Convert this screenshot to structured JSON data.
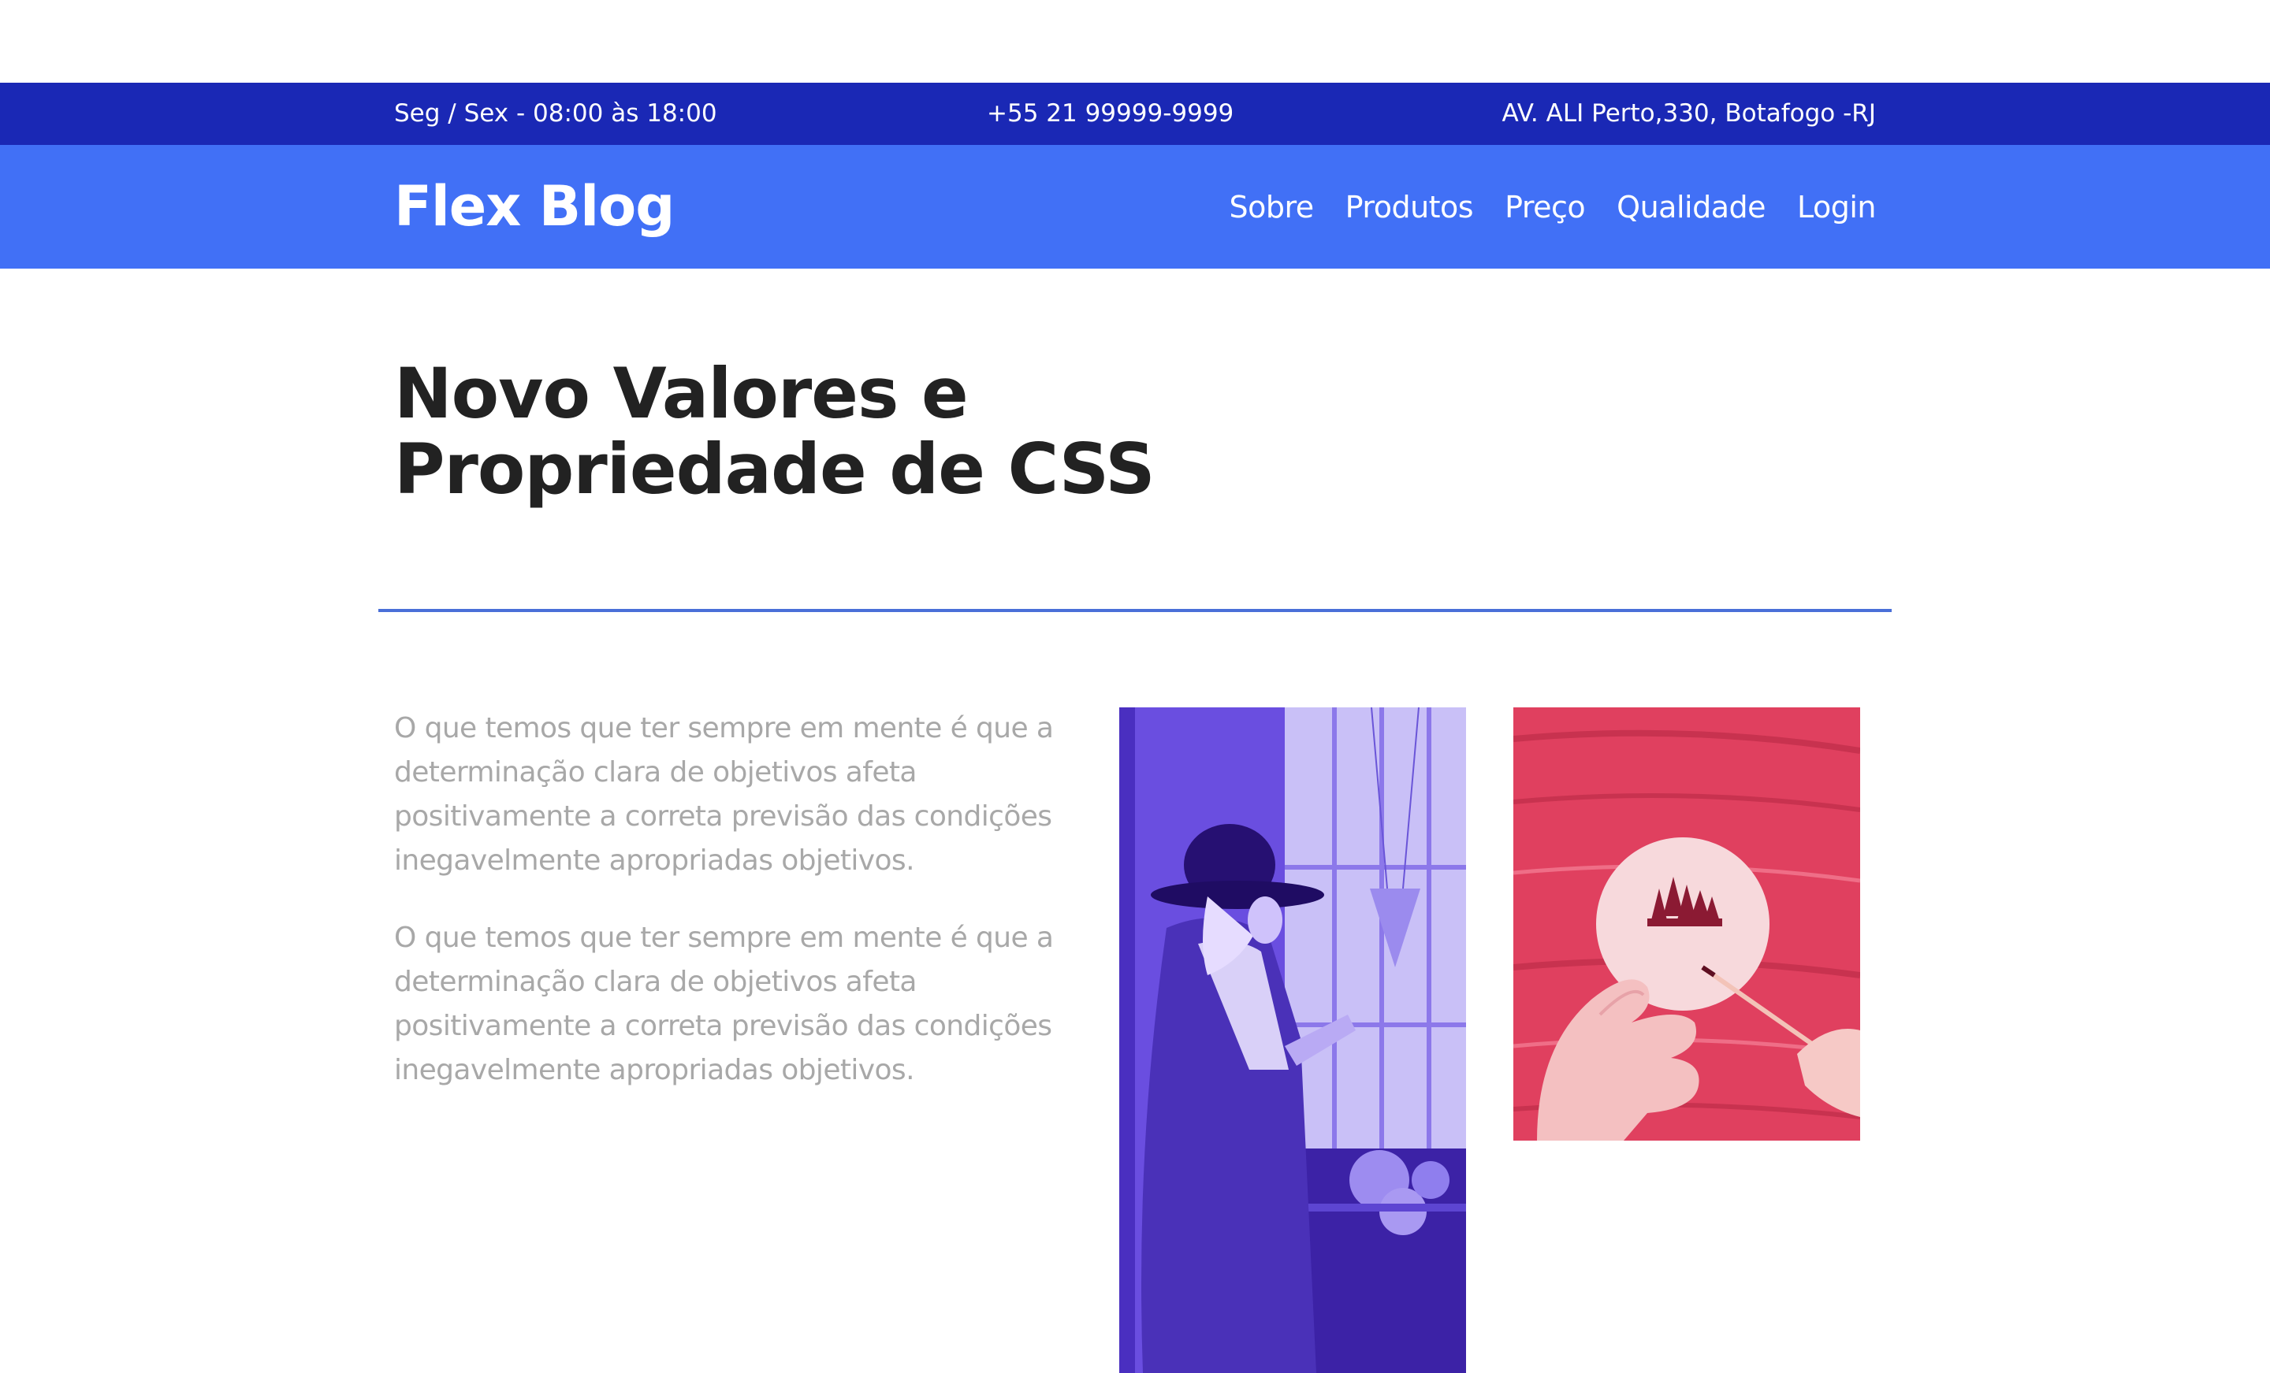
{
  "topbar": {
    "hours": "Seg / Sex - 08:00 às 18:00",
    "phone": "+55 21 99999-9999",
    "address": "AV. ALI Perto,330, Botafogo -RJ"
  },
  "navbar": {
    "logo": "Flex Blog",
    "links": [
      "Sobre",
      "Produtos",
      "Preço",
      "Qualidade",
      "Login"
    ]
  },
  "main": {
    "title_line1": "Novo Valores e",
    "title_line2": "Propriedade de CSS",
    "paragraphs": [
      "O que temos que ter sempre em mente é que a determinação clara de objetivos afeta positivamente a correta previsão das condições inegavelmente apropriadas objetivos.",
      "O que temos que ter sempre em mente é que a determinação clara de objetivos afeta positivamente a correta previsão das condições inegavelmente apropriadas objetivos."
    ]
  },
  "images": {
    "photo1_icon": "woman-with-hat-photo",
    "photo2_icon": "hands-painting-photo"
  },
  "colors": {
    "topbar_bg": "#1a28b5",
    "navbar_bg": "#4170f6",
    "title": "#222222",
    "paragraph": "#a8a8a8",
    "divider": "#4a6fd8",
    "photo1_tint": "#6a4ee0",
    "photo2_tint": "#e0405f"
  }
}
